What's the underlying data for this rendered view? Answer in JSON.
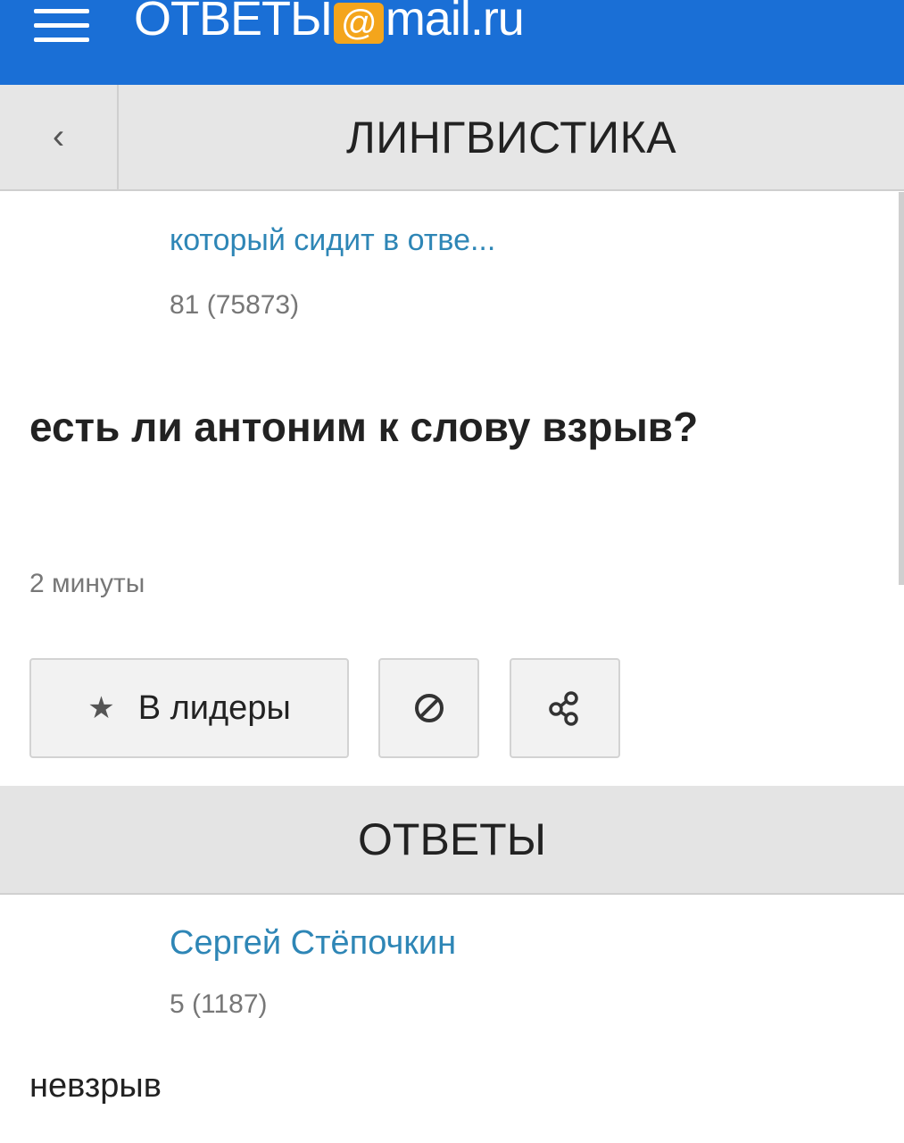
{
  "header": {
    "logo_prefix": "ОТВЕТЫ",
    "logo_at": "@",
    "logo_suffix": "mail.ru",
    "brand_color": "#1a6fd6",
    "at_color": "#f4a51c"
  },
  "category": {
    "back_icon": "‹",
    "title": "ЛИНГВИСТИКА"
  },
  "question": {
    "author_name": "который сидит в отве...",
    "author_score": "81 (75873)",
    "text": "есть ли антоним к слову взрыв?",
    "time": "2 минуты"
  },
  "actions": {
    "leaders_label": "В лидеры",
    "leaders_icon": "★",
    "block_icon": "block-icon",
    "share_icon": "share-icon"
  },
  "answers": {
    "header": "ОТВЕТЫ",
    "items": [
      {
        "author_name": "Сергей Стёпочкин",
        "author_score": "5 (1187)",
        "text": "невзрыв"
      }
    ]
  }
}
